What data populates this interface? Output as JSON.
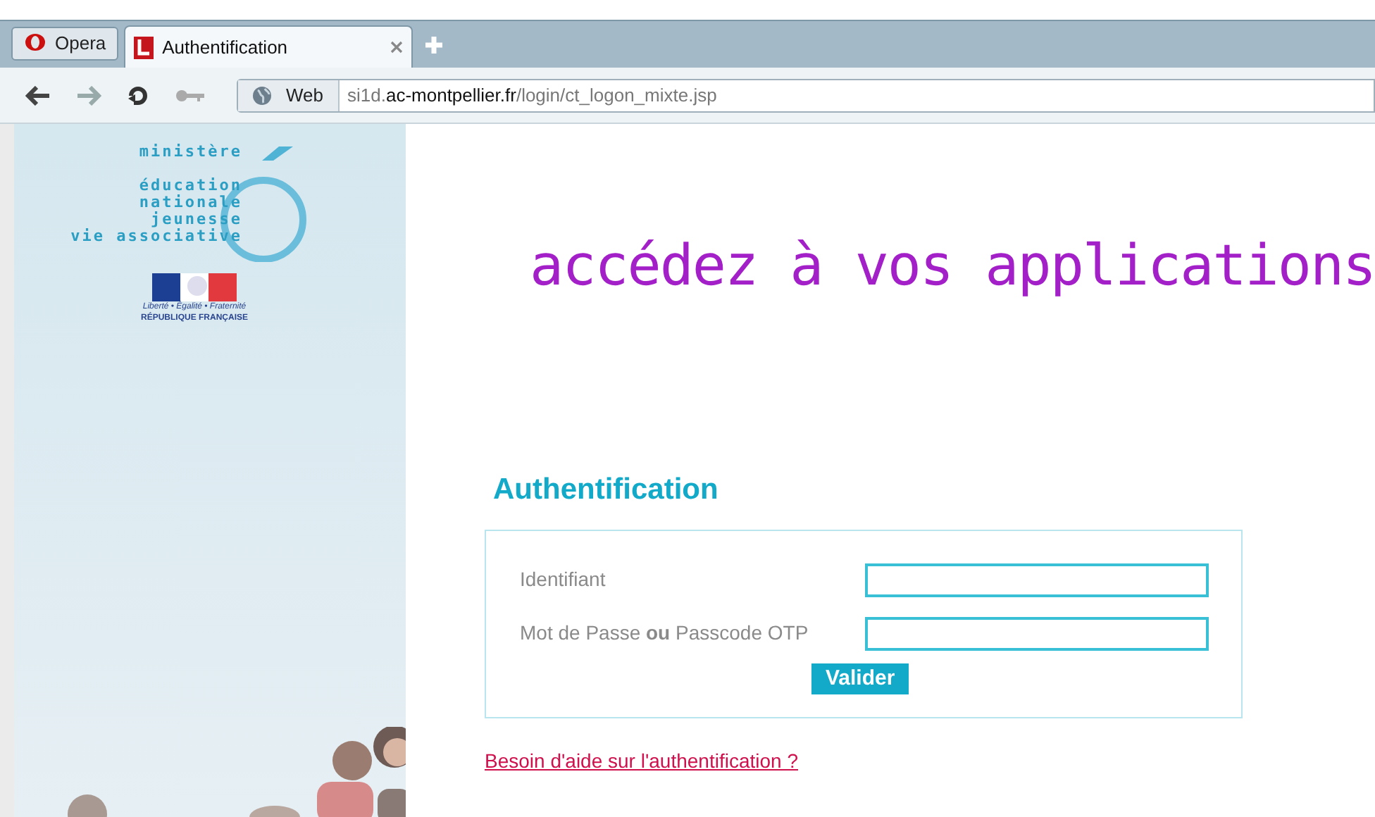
{
  "browser": {
    "menu_button": "Opera",
    "tabs": [
      {
        "title": "Authentification",
        "selected": true
      }
    ],
    "nav": {
      "web_label": "Web",
      "url_host_prefix": "si1d.",
      "url_host": "ac-montpellier.fr",
      "url_path": "/login/ct_logon_mixte.jsp"
    }
  },
  "sidebar": {
    "logo_lines": [
      "ministère",
      "éducation",
      "nationale",
      "jeunesse",
      "vie associative"
    ],
    "motto": "Liberté • Égalité • Fraternité",
    "republic": "RÉPUBLIQUE FRANÇAISE"
  },
  "banner": "accédez à vos applications",
  "form": {
    "title": "Authentification",
    "fields": [
      {
        "label": "Identifiant"
      },
      {
        "label": "Mot de Passe **ou** Passcode OTP"
      }
    ],
    "submit": "Valider"
  },
  "help_link": "Besoin d'aide sur l'authentification ?"
}
